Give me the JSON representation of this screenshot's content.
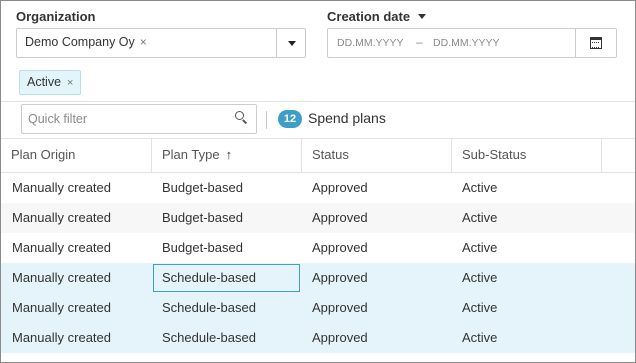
{
  "filters": {
    "organization_label": "Organization",
    "organization_chip": "Demo Company Oy",
    "chip_remove_glyph": "×",
    "dropdown_icon": "chevron-down-icon",
    "creation_date_label": "Creation date",
    "date_from_placeholder": "DD.MM.YYYY",
    "date_separator": "–",
    "date_to_placeholder": "DD.MM.YYYY",
    "calendar_icon": "calendar-icon",
    "status_chip": "Active"
  },
  "toolbar": {
    "quick_filter_placeholder": "Quick filter",
    "search_icon": "search-icon",
    "count": "12",
    "count_label": "Spend plans"
  },
  "grid": {
    "columns": [
      {
        "label": "Plan Origin",
        "sort": ""
      },
      {
        "label": "Plan Type",
        "sort": "↑"
      },
      {
        "label": "Status",
        "sort": ""
      },
      {
        "label": "Sub-Status",
        "sort": ""
      }
    ],
    "rows": [
      {
        "origin": "Manually created",
        "type": "Budget-based",
        "status": "Approved",
        "substatus": "Active"
      },
      {
        "origin": "Manually created",
        "type": "Budget-based",
        "status": "Approved",
        "substatus": "Active"
      },
      {
        "origin": "Manually created",
        "type": "Budget-based",
        "status": "Approved",
        "substatus": "Active"
      },
      {
        "origin": "Manually created",
        "type": "Schedule-based",
        "status": "Approved",
        "substatus": "Active"
      },
      {
        "origin": "Manually created",
        "type": "Schedule-based",
        "status": "Approved",
        "substatus": "Active"
      },
      {
        "origin": "Manually created",
        "type": "Schedule-based",
        "status": "Approved",
        "substatus": "Active"
      }
    ]
  },
  "colors": {
    "accent": "#3d9fc7",
    "selected_row": "#e5f4fa",
    "chip_bg": "#e3f4fa"
  }
}
